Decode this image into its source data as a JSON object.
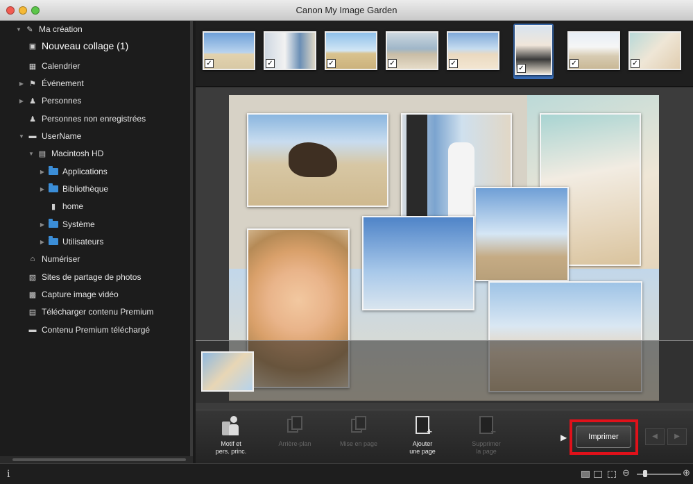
{
  "window": {
    "title": "Canon My Image Garden"
  },
  "sidebar": {
    "items": [
      {
        "label": "Ma création",
        "icon": "edit-icon",
        "arrow": "▼"
      },
      {
        "label": "Nouveau collage (1)",
        "icon": "collage-icon",
        "arrow": ""
      },
      {
        "label": "Calendrier",
        "icon": "calendar-icon",
        "arrow": ""
      },
      {
        "label": "Événement",
        "icon": "event-icon",
        "arrow": "▶"
      },
      {
        "label": "Personnes",
        "icon": "person-icon",
        "arrow": "▶"
      },
      {
        "label": "Personnes non enregistrées",
        "icon": "unregistered-person-icon",
        "arrow": ""
      },
      {
        "label": "UserName",
        "icon": "drive-icon",
        "arrow": "▼"
      },
      {
        "label": "Macintosh HD",
        "icon": "hard-disk-icon",
        "arrow": "▼"
      },
      {
        "label": "Applications",
        "icon": "folder-icon",
        "arrow": "▶"
      },
      {
        "label": "Bibliothèque",
        "icon": "folder-icon",
        "arrow": "▶"
      },
      {
        "label": "home",
        "icon": "document-icon",
        "arrow": ""
      },
      {
        "label": "Système",
        "icon": "folder-icon",
        "arrow": "▶"
      },
      {
        "label": "Utilisateurs",
        "icon": "folder-icon",
        "arrow": "▶"
      },
      {
        "label": "Numériser",
        "icon": "scan-icon",
        "arrow": ""
      },
      {
        "label": "Sites de partage de photos",
        "icon": "photo-share-icon",
        "arrow": ""
      },
      {
        "label": "Capture image vidéo",
        "icon": "video-capture-icon",
        "arrow": ""
      },
      {
        "label": "Télécharger contenu Premium",
        "icon": "download-icon",
        "arrow": ""
      },
      {
        "label": "Contenu Premium téléchargé",
        "icon": "folder-icon",
        "arrow": ""
      }
    ]
  },
  "toolbar": {
    "motif_label_1": "Motif et",
    "motif_label_2": "pers. princ.",
    "background_label": "Arrière-plan",
    "layout_label": "Mise en page",
    "add_page_label_1": "Ajouter",
    "add_page_label_2": "une page",
    "delete_page_label_1": "Supprimer",
    "delete_page_label_2": "la page",
    "print_label": "Imprimer",
    "prev_icon": "◀",
    "next_icon": "▶"
  },
  "filmstrip": {
    "check_mark": "✓"
  },
  "statusbar": {
    "info_icon": "i",
    "zoom_minus": "⊖",
    "zoom_plus": "⊕"
  },
  "colors": {
    "print_highlight": "#e0111a",
    "selected_thumb": "#3a6fb8",
    "folder": "#3b8ed8"
  }
}
